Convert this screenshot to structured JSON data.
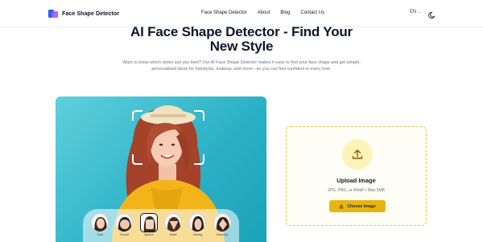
{
  "header": {
    "brand": "Face Shape Detector",
    "nav": [
      "Face Shape Detector",
      "About",
      "Blog",
      "Contact Us"
    ],
    "language": "EN",
    "logo_icon": "brand-logo-icon",
    "theme_icon": "moon-icon"
  },
  "hero": {
    "title_line1": "AI Face Shape Detector - Find Your",
    "title_line2": "New Style",
    "description": "Want to know which styles suit you best? Our AI Face Shape Detector makes it easy to find your face shape and get simple, personalized ideas for hairstyles, makeup, and more—so you can feel confident in every look."
  },
  "preview": {
    "thumbnails": [
      {
        "label": "Oval",
        "active": false
      },
      {
        "label": "Round",
        "active": false
      },
      {
        "label": "Square",
        "active": true
      },
      {
        "label": "Heart",
        "active": false
      },
      {
        "label": "Oblong",
        "active": false
      },
      {
        "label": "Diamond",
        "active": false
      }
    ]
  },
  "upload": {
    "title": "Upload Image",
    "hint": "JPG, PNG, or WebP • Max 5MB",
    "button_label": "Choose Image",
    "icon": "upload-icon"
  },
  "colors": {
    "accent": "#e8b50f",
    "accent_soft": "#fdf3b8",
    "photo_bg": "#2bb1c6"
  }
}
